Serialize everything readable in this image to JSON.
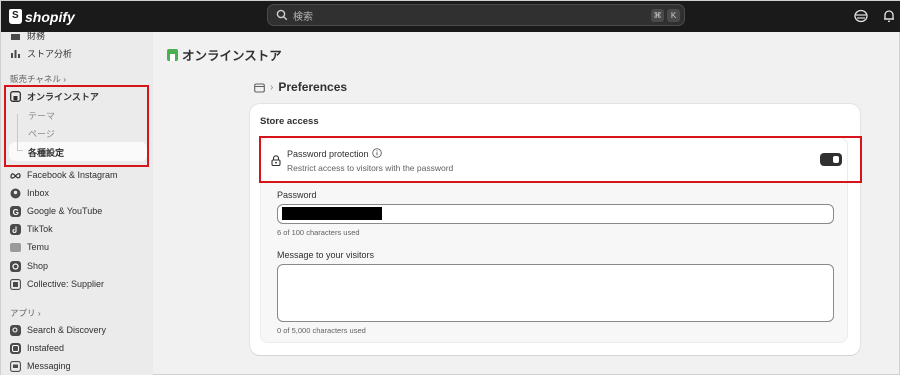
{
  "app": {
    "brand": "shopify"
  },
  "search": {
    "placeholder": "検索",
    "shortcut_mod": "⌘",
    "shortcut_key": "K"
  },
  "sidebar": {
    "top_items": [
      {
        "label": "財務",
        "icon": "bank-icon"
      },
      {
        "label": "ストア分析",
        "icon": "bar-chart-icon"
      }
    ],
    "sales_channels_header": "販売チャネル",
    "online_store": {
      "label": "オンラインストア",
      "icon": "online-store-icon"
    },
    "online_store_sub": [
      "テーマ",
      "ページ",
      "各種設定"
    ],
    "channels": [
      {
        "label": "Facebook & Instagram",
        "icon": "meta-icon"
      },
      {
        "label": "Inbox",
        "icon": "inbox-icon"
      },
      {
        "label": "Google & YouTube",
        "icon": "google-icon"
      },
      {
        "label": "TikTok",
        "icon": "tiktok-icon"
      },
      {
        "label": "Temu",
        "icon": "temu-icon"
      },
      {
        "label": "Shop",
        "icon": "shop-icon"
      },
      {
        "label": "Collective: Supplier",
        "icon": "collective-icon"
      }
    ],
    "apps_header": "アプリ",
    "apps": [
      {
        "label": "Search & Discovery",
        "icon": "search-discovery-icon"
      },
      {
        "label": "Instafeed",
        "icon": "instafeed-icon"
      },
      {
        "label": "Messaging",
        "icon": "messaging-icon"
      }
    ]
  },
  "main": {
    "page_title": "オンラインストア",
    "breadcrumb_title": "Preferences",
    "card": {
      "title": "Store access",
      "password_protection": {
        "label": "Password protection",
        "description": "Restrict access to visitors with the password",
        "enabled": true
      },
      "password": {
        "label": "Password",
        "helper": "6 of 100 characters used"
      },
      "message": {
        "label": "Message to your visitors",
        "value": "",
        "helper": "0 of 5,000 characters used"
      }
    }
  },
  "colors": {
    "topbar": "#1a1a1a",
    "highlight": "#d7141a",
    "sidebar": "#ebebeb",
    "page_bg": "#f1f1f1",
    "online_store_green": "#4caf50"
  }
}
